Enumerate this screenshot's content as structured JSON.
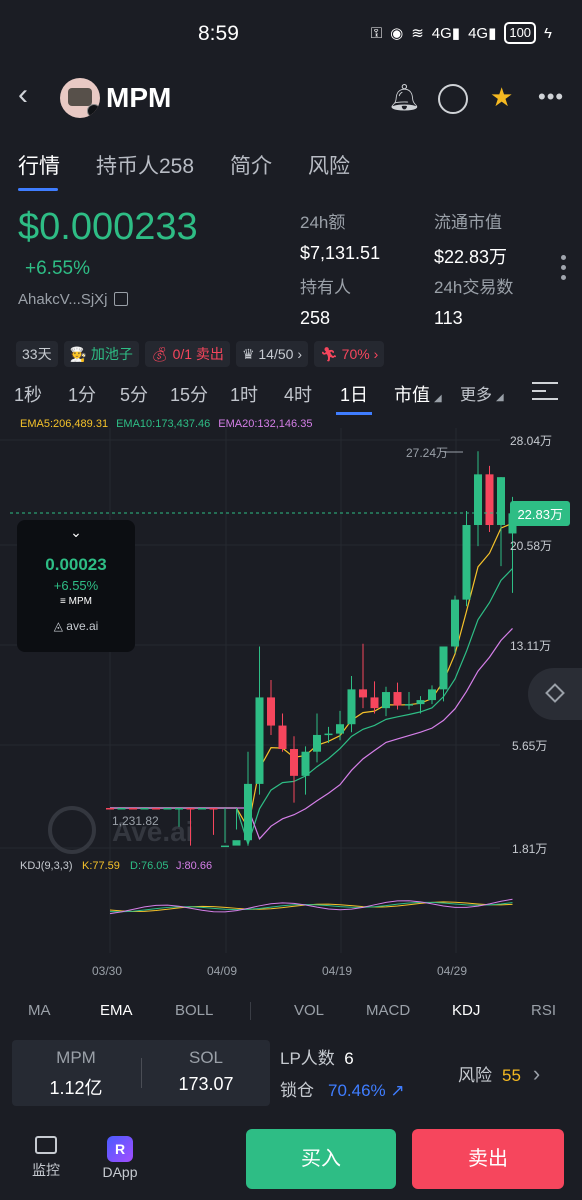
{
  "status": {
    "time": "8:59",
    "network1": "4G",
    "network2": "4G",
    "battery": "100"
  },
  "header": {
    "title": "MPM"
  },
  "tabs": [
    {
      "label": "行情",
      "active": true
    },
    {
      "label": "持币人258"
    },
    {
      "label": "简介"
    },
    {
      "label": "风险"
    }
  ],
  "price": {
    "value": "$0.000233",
    "change": "+6.55%",
    "address": "AhakcV...SjXj"
  },
  "stats": {
    "vol24h_label": "24h额",
    "vol24h": "$7,131.51",
    "mcap_label": "流通市值",
    "mcap": "$22.83万",
    "holders_label": "持有人",
    "holders": "258",
    "tx24h_label": "24h交易数",
    "tx24h": "113"
  },
  "chips": {
    "age": "33天",
    "pool": "加池子",
    "sell_ratio": "0/1 卖出",
    "rank": "14/50",
    "percent": "70%"
  },
  "timeframes": [
    "1秒",
    "1分",
    "5分",
    "15分",
    "1时",
    "4时",
    "1日"
  ],
  "tf_market": "市值",
  "tf_more": "更多",
  "ema": {
    "ema5": "EMA5:206,489.31",
    "ema10": "EMA10:173,437.46",
    "ema20": "EMA20:132,146.35",
    "colors": {
      "ema5": "#f5c22a",
      "ema10": "#2ebd85",
      "ema20": "#d57fe8"
    }
  },
  "chart_labels": {
    "y_ticks": [
      "28.04万",
      "20.58万",
      "13.11万",
      "5.65万",
      "1.81万"
    ],
    "current_tag": "22.83万",
    "high_label": "27.24万",
    "low_label": "1,231.82",
    "kdj": "KDJ(9,3,3)",
    "k": "K:77.59",
    "d": "D:76.05",
    "j": "J:80.66",
    "dates": [
      "03/30",
      "04/09",
      "04/19",
      "04/29"
    ],
    "watermark": "Ave.ai"
  },
  "chart_data": {
    "type": "candlestick",
    "ylabel": "市值",
    "y_ticks": [
      28.04,
      20.58,
      13.11,
      5.65,
      1.81
    ],
    "units": "万",
    "candles": [
      {
        "o": 1.4,
        "h": 1.6,
        "l": 0.12,
        "c": 0.4
      },
      {
        "o": 0.4,
        "h": 1.3,
        "l": 0.3,
        "c": 1.1
      },
      {
        "o": 1.1,
        "h": 1.4,
        "l": 0.5,
        "c": 0.7
      },
      {
        "o": 0.7,
        "h": 1.2,
        "l": 0.5,
        "c": 1.0
      },
      {
        "o": 1.0,
        "h": 1.5,
        "l": 0.8,
        "c": 0.9
      },
      {
        "o": 0.9,
        "h": 1.4,
        "l": 0.7,
        "c": 1.2
      },
      {
        "o": 1.2,
        "h": 2.6,
        "l": 1.0,
        "c": 1.5
      },
      {
        "o": 1.5,
        "h": 1.9,
        "l": 1.0,
        "c": 1.3
      },
      {
        "o": 1.3,
        "h": 1.8,
        "l": 1.1,
        "c": 1.7
      },
      {
        "o": 1.7,
        "h": 2.3,
        "l": 1.2,
        "c": 1.5
      },
      {
        "o": 1.5,
        "h": 2.0,
        "l": 1.3,
        "c": 1.9
      },
      {
        "o": 1.9,
        "h": 2.5,
        "l": 1.7,
        "c": 2.1
      },
      {
        "o": 2.1,
        "h": 5.4,
        "l": 1.9,
        "c": 4.2
      },
      {
        "o": 4.2,
        "h": 13.0,
        "l": 3.8,
        "c": 9.2
      },
      {
        "o": 9.2,
        "h": 10.5,
        "l": 6.4,
        "c": 7.1
      },
      {
        "o": 7.1,
        "h": 8.0,
        "l": 5.4,
        "c": 5.5
      },
      {
        "o": 5.5,
        "h": 6.3,
        "l": 3.5,
        "c": 4.5
      },
      {
        "o": 4.5,
        "h": 5.6,
        "l": 3.8,
        "c": 5.4
      },
      {
        "o": 5.4,
        "h": 8.0,
        "l": 5.0,
        "c": 6.4
      },
      {
        "o": 6.4,
        "h": 7.0,
        "l": 5.8,
        "c": 6.5
      },
      {
        "o": 6.5,
        "h": 8.2,
        "l": 6.0,
        "c": 7.2
      },
      {
        "o": 7.2,
        "h": 10.8,
        "l": 6.6,
        "c": 9.8
      },
      {
        "o": 9.8,
        "h": 13.2,
        "l": 8.4,
        "c": 9.2
      },
      {
        "o": 9.2,
        "h": 10.4,
        "l": 8.0,
        "c": 8.4
      },
      {
        "o": 8.4,
        "h": 10.0,
        "l": 7.8,
        "c": 9.6
      },
      {
        "o": 9.6,
        "h": 10.3,
        "l": 8.3,
        "c": 8.6
      },
      {
        "o": 8.6,
        "h": 9.6,
        "l": 8.3,
        "c": 8.7
      },
      {
        "o": 8.7,
        "h": 9.3,
        "l": 8.0,
        "c": 9.0
      },
      {
        "o": 9.0,
        "h": 10.1,
        "l": 8.7,
        "c": 9.8
      },
      {
        "o": 9.8,
        "h": 13.0,
        "l": 8.9,
        "c": 13.0
      },
      {
        "o": 13.0,
        "h": 16.8,
        "l": 12.5,
        "c": 16.5
      },
      {
        "o": 16.5,
        "h": 23.0,
        "l": 16.0,
        "c": 22.0
      },
      {
        "o": 22.0,
        "h": 27.24,
        "l": 20.5,
        "c": 25.6
      },
      {
        "o": 25.6,
        "h": 26.2,
        "l": 21.5,
        "c": 22.0
      },
      {
        "o": 22.0,
        "h": 25.4,
        "l": 19.0,
        "c": 25.4
      },
      {
        "o": 21.4,
        "h": 24.0,
        "l": 17.0,
        "c": 22.83
      }
    ]
  },
  "popup": {
    "value": "0.00023",
    "change": "+6.55%",
    "token": "MPM",
    "source": "ave.ai"
  },
  "indicators": [
    "MA",
    "EMA",
    "BOLL",
    "VOL",
    "MACD",
    "KDJ",
    "RSI"
  ],
  "bottom": {
    "mpm_label": "MPM",
    "mpm_value": "1.12亿",
    "sol_label": "SOL",
    "sol_value": "173.07",
    "lp_label": "LP人数",
    "lp_value": "6",
    "lock_label": "锁仓",
    "lock_value": "70.46%",
    "risk_label": "风险",
    "risk_value": "55"
  },
  "nav": {
    "monitor": "监控",
    "dapp": "DApp",
    "buy": "买入",
    "sell": "卖出"
  }
}
